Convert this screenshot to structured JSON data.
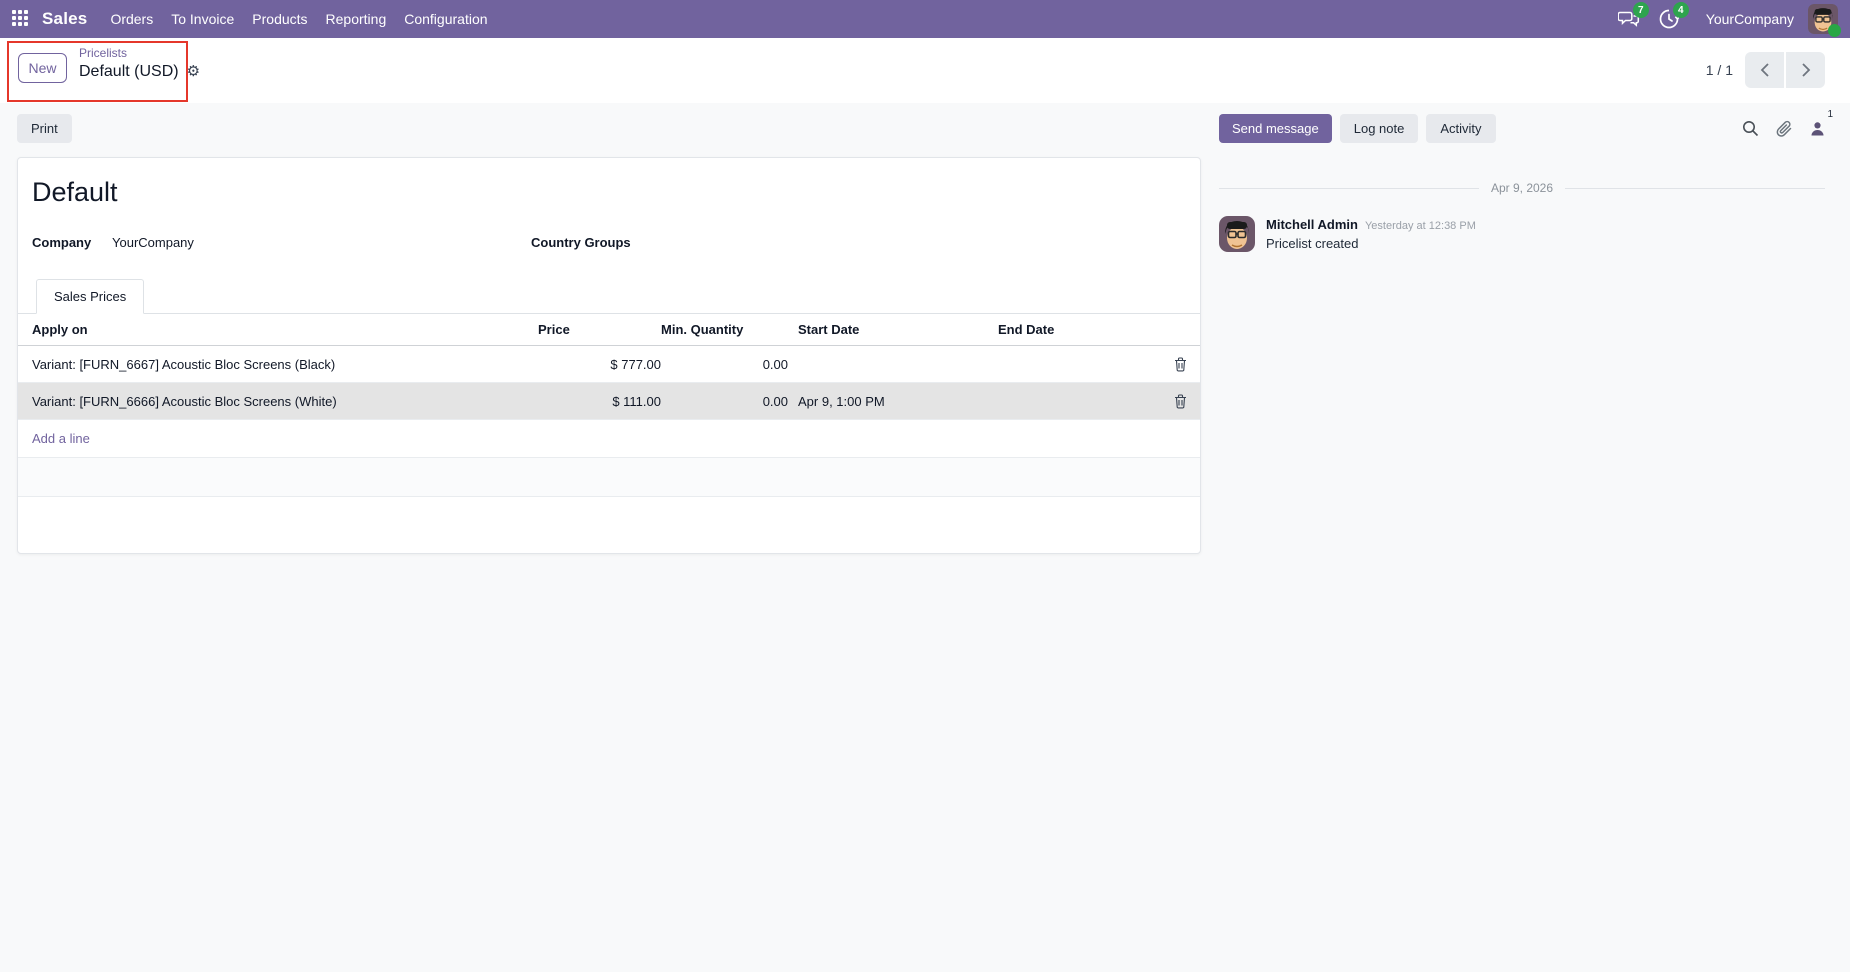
{
  "nav": {
    "app_name": "Sales",
    "menu_items": [
      "Orders",
      "To Invoice",
      "Products",
      "Reporting",
      "Configuration"
    ],
    "messages_badge": "7",
    "activities_badge": "4",
    "company": "YourCompany"
  },
  "control_panel": {
    "new_button": "New",
    "breadcrumb_parent": "Pricelists",
    "breadcrumb_current": "Default (USD)",
    "pager": "1 / 1"
  },
  "form": {
    "print_button": "Print",
    "title": "Default",
    "company_label": "Company",
    "company_value": "YourCompany",
    "country_groups_label": "Country Groups",
    "tab_label": "Sales Prices",
    "table": {
      "headers": {
        "apply_on": "Apply on",
        "price": "Price",
        "min_quantity": "Min. Quantity",
        "start_date": "Start Date",
        "end_date": "End Date"
      },
      "rows": [
        {
          "apply_on": "Variant: [FURN_6667] Acoustic Bloc Screens (Black)",
          "price": "$ 777.00",
          "min_quantity": "0.00",
          "start_date": "",
          "end_date": ""
        },
        {
          "apply_on": "Variant: [FURN_6666] Acoustic Bloc Screens (White)",
          "price": "$ 111.00",
          "min_quantity": "0.00",
          "start_date": "Apr 9, 1:00 PM",
          "end_date": ""
        }
      ],
      "add_line": "Add a line"
    }
  },
  "chatter": {
    "send_message": "Send message",
    "log_note": "Log note",
    "activity": "Activity",
    "followers_count": "1",
    "date_separator": "Apr 9, 2026",
    "message": {
      "author": "Mitchell Admin",
      "timestamp": "Yesterday at 12:38 PM",
      "body": "Pricelist created"
    }
  },
  "colors": {
    "accent": "#71639e",
    "badge_green": "#2ea44e",
    "annotation_red": "#e5372b",
    "online_green": "#28a745"
  }
}
